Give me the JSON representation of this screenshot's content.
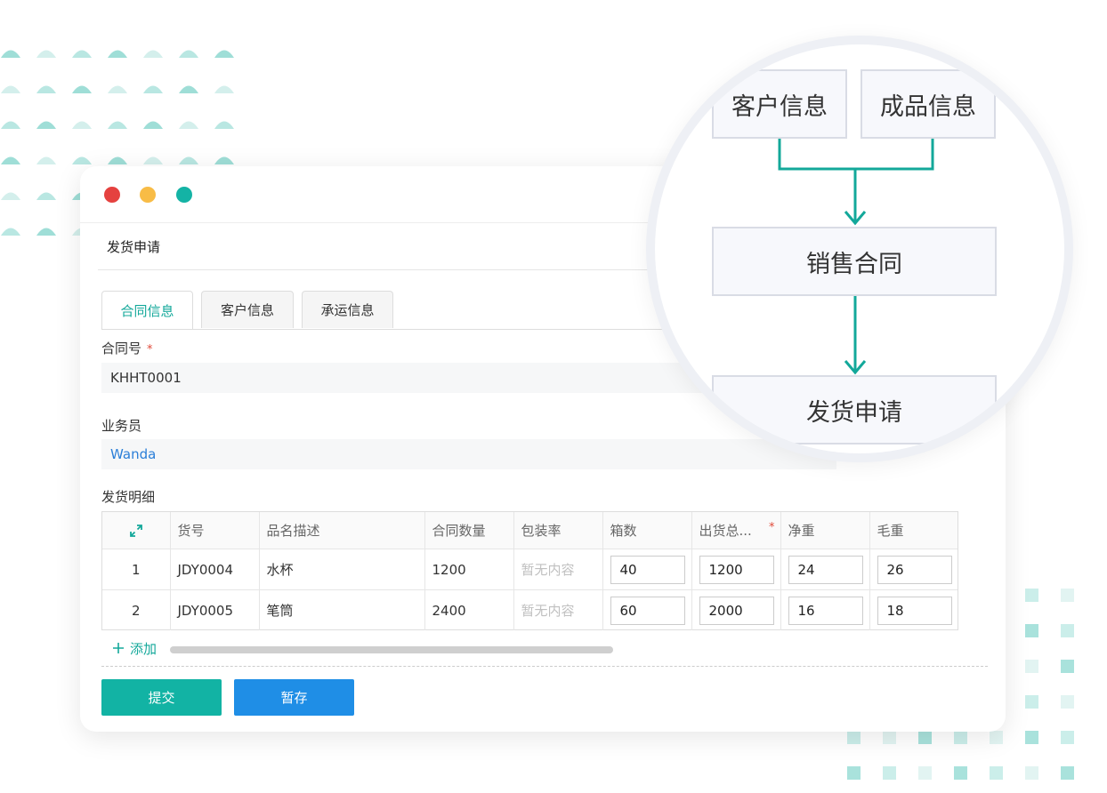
{
  "colors": {
    "accent": "#13a89a",
    "submit": "#12b3a4",
    "draft": "#1f8ee6",
    "link": "#2b7fd8",
    "required": "#e04a3a",
    "traffic": [
      "#e5413f",
      "#f8bc46",
      "#14b3a5"
    ]
  },
  "icons": {
    "expand": "expand-arrows-icon",
    "add": "plus-icon"
  },
  "page": {
    "title": "发货申请"
  },
  "tabs": [
    {
      "label": "合同信息",
      "active": true
    },
    {
      "label": "客户信息",
      "active": false
    },
    {
      "label": "承运信息",
      "active": false
    }
  ],
  "form": {
    "contract_no": {
      "label": "合同号",
      "required": "*",
      "value": "KHHT0001"
    },
    "salesperson": {
      "label": "业务员",
      "value": "Wanda"
    },
    "details_label": "发货明细"
  },
  "table": {
    "headers": [
      "货号",
      "品名描述",
      "合同数量",
      "包装率",
      "箱数",
      "出货总...",
      "净重",
      "毛重"
    ],
    "header_required": "*",
    "rows": [
      {
        "idx": "1",
        "code": "JDY0004",
        "name": "水杯",
        "qty": "1200",
        "pack": "暂无内容",
        "boxes": "40",
        "total": "1200",
        "net": "24",
        "gross": "26"
      },
      {
        "idx": "2",
        "code": "JDY0005",
        "name": "笔筒",
        "qty": "2400",
        "pack": "暂无内容",
        "boxes": "60",
        "total": "2000",
        "net": "16",
        "gross": "18"
      }
    ],
    "add_label": "添加"
  },
  "buttons": {
    "submit": "提交",
    "draft": "暂存"
  },
  "flow": {
    "top_left": "客户信息",
    "top_right": "成品信息",
    "middle": "销售合同",
    "bottom": "发货申请"
  }
}
